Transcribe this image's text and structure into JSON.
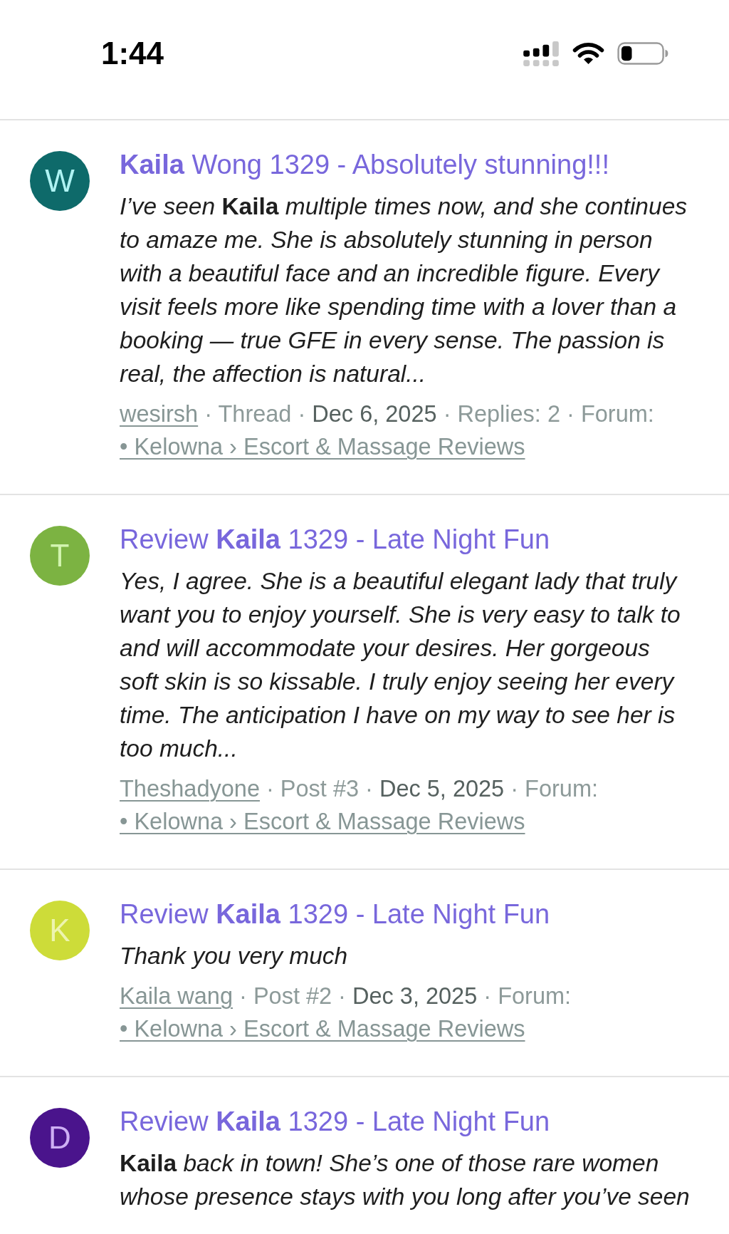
{
  "status_bar": {
    "time": "1:44"
  },
  "posts": [
    {
      "avatar": {
        "letter": "W",
        "color": "#0e6a6a"
      },
      "title": "**Kaila** Wong 1329 - Absolutely stunning!!!",
      "excerpt": "I’ve seen **Kaila** multiple times now, and she continues to amaze me. She is absolutely stunning in person with a beautiful face and an incredible figure. Every visit feels more like spending time with a lover than a booking — true GFE in every sense. The passion is real, the affection is natural...",
      "meta": [
        {
          "kind": "user",
          "text": "wesirsh"
        },
        {
          "kind": "text",
          "text": "· Thread ·"
        },
        {
          "kind": "date",
          "text": "Dec 6, 2025"
        },
        {
          "kind": "text",
          "text": "· Replies: 2 · Forum:"
        },
        {
          "kind": "forum",
          "text": "• Kelowna › Escort & Massage Reviews"
        }
      ]
    },
    {
      "avatar": {
        "letter": "T",
        "color": "#7cb342"
      },
      "title": "Review **Kaila** 1329 - Late Night Fun",
      "excerpt": "Yes, I agree. She is a beautiful elegant lady that truly want you to enjoy yourself. She is very easy to talk to and will accommodate your desires. Her gorgeous soft skin is so kissable. I truly enjoy seeing her every time. The anticipation I have on my way to see her is too much...",
      "meta": [
        {
          "kind": "user",
          "text": "Theshadyone"
        },
        {
          "kind": "text",
          "text": "· Post #3 ·"
        },
        {
          "kind": "date",
          "text": "Dec 5, 2025"
        },
        {
          "kind": "text",
          "text": "· Forum:"
        },
        {
          "kind": "forum",
          "text": "• Kelowna › Escort & Massage Reviews"
        }
      ]
    },
    {
      "avatar": {
        "letter": "K",
        "color": "#cddc39"
      },
      "title": "Review **Kaila** 1329 - Late Night Fun",
      "excerpt": "Thank you very much",
      "meta": [
        {
          "kind": "user",
          "text": "Kaila wang"
        },
        {
          "kind": "text",
          "text": "· Post #2 ·"
        },
        {
          "kind": "date",
          "text": "Dec 3, 2025"
        },
        {
          "kind": "text",
          "text": "· Forum:"
        },
        {
          "kind": "forum",
          "text": "• Kelowna › Escort & Massage Reviews"
        }
      ]
    },
    {
      "avatar": {
        "letter": "D",
        "color": "#4a148c"
      },
      "title": "Review **Kaila** 1329 - Late Night Fun",
      "excerpt": "**Kaila** back in town! She’s one of those rare women whose presence stays with you long after you’ve seen"
    }
  ]
}
